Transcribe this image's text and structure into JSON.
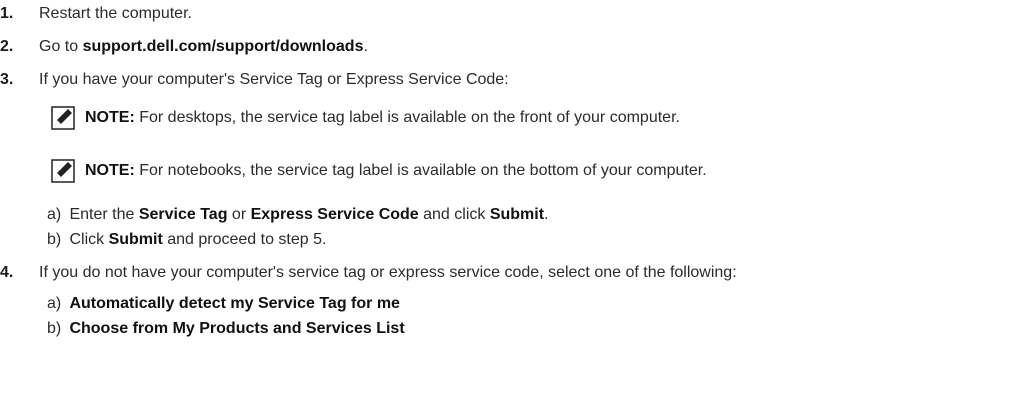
{
  "steps": [
    {
      "num": "1.",
      "text": "Restart the computer."
    },
    {
      "num": "2.",
      "pre": "Go to ",
      "link": "support.dell.com/support/downloads",
      "post": "."
    },
    {
      "num": "3.",
      "text": "If you have your computer's Service Tag or Express Service Code:"
    },
    {
      "num": "4.",
      "text": "If you do not have your computer's service tag or express service code, select one of the following:"
    }
  ],
  "notes": [
    {
      "label": "NOTE:",
      "text": " For desktops, the service tag label is available on the front of your computer."
    },
    {
      "label": "NOTE:",
      "text": " For notebooks, the service tag label is available on the bottom of your computer."
    }
  ],
  "step3_subs": {
    "a": {
      "lbl": "a)",
      "t1": "Enter the ",
      "b1": "Service Tag",
      "t2": " or ",
      "b2": "Express Service Code",
      "t3": " and click ",
      "b3": "Submit",
      "t4": "."
    },
    "b": {
      "lbl": "b)",
      "t1": "Click ",
      "b1": "Submit",
      "t2": " and proceed to step 5."
    }
  },
  "step4_subs": [
    {
      "lbl": "a)",
      "text": "Automatically detect my Service Tag for me"
    },
    {
      "lbl": "b)",
      "text": "Choose from My Products and Services List"
    }
  ]
}
